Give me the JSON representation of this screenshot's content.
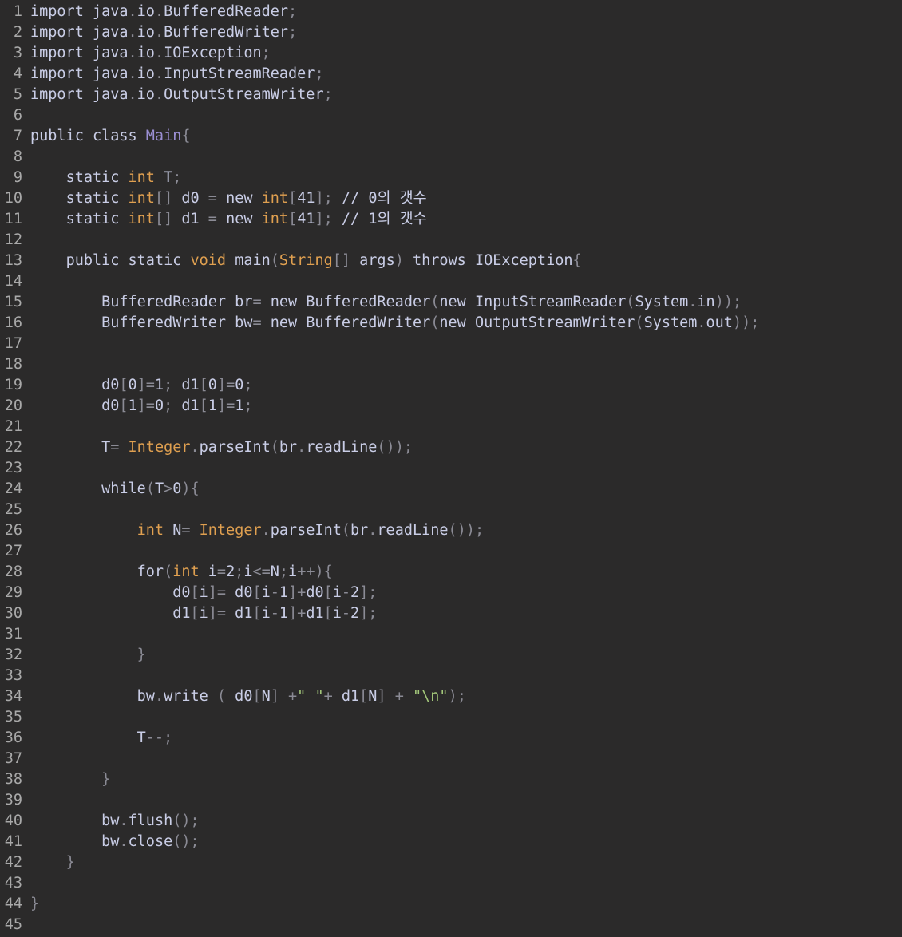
{
  "editor": {
    "language": "java",
    "colors": {
      "background": "#2b2a2a",
      "gutter": "#a9a9a9",
      "keyword": "#c9cde6",
      "type": "#e0a050",
      "class_name": "#9b8fd4",
      "punctuation": "#8b8b95",
      "string": "#a3c77a"
    },
    "lines": [
      [
        {
          "t": "kw",
          "v": "import "
        },
        {
          "t": "plain",
          "v": "java"
        },
        {
          "t": "punc",
          "v": "."
        },
        {
          "t": "plain",
          "v": "io"
        },
        {
          "t": "punc",
          "v": "."
        },
        {
          "t": "plain",
          "v": "BufferedReader"
        },
        {
          "t": "punc",
          "v": ";"
        }
      ],
      [
        {
          "t": "kw",
          "v": "import "
        },
        {
          "t": "plain",
          "v": "java"
        },
        {
          "t": "punc",
          "v": "."
        },
        {
          "t": "plain",
          "v": "io"
        },
        {
          "t": "punc",
          "v": "."
        },
        {
          "t": "plain",
          "v": "BufferedWriter"
        },
        {
          "t": "punc",
          "v": ";"
        }
      ],
      [
        {
          "t": "kw",
          "v": "import "
        },
        {
          "t": "plain",
          "v": "java"
        },
        {
          "t": "punc",
          "v": "."
        },
        {
          "t": "plain",
          "v": "io"
        },
        {
          "t": "punc",
          "v": "."
        },
        {
          "t": "plain",
          "v": "IOException"
        },
        {
          "t": "punc",
          "v": ";"
        }
      ],
      [
        {
          "t": "kw",
          "v": "import "
        },
        {
          "t": "plain",
          "v": "java"
        },
        {
          "t": "punc",
          "v": "."
        },
        {
          "t": "plain",
          "v": "io"
        },
        {
          "t": "punc",
          "v": "."
        },
        {
          "t": "plain",
          "v": "InputStreamReader"
        },
        {
          "t": "punc",
          "v": ";"
        }
      ],
      [
        {
          "t": "kw",
          "v": "import "
        },
        {
          "t": "plain",
          "v": "java"
        },
        {
          "t": "punc",
          "v": "."
        },
        {
          "t": "plain",
          "v": "io"
        },
        {
          "t": "punc",
          "v": "."
        },
        {
          "t": "plain",
          "v": "OutputStreamWriter"
        },
        {
          "t": "punc",
          "v": ";"
        }
      ],
      [],
      [
        {
          "t": "kw",
          "v": "public class "
        },
        {
          "t": "cls",
          "v": "Main"
        },
        {
          "t": "punc",
          "v": "{"
        }
      ],
      [],
      [
        {
          "t": "plain",
          "v": "    "
        },
        {
          "t": "kw",
          "v": "static "
        },
        {
          "t": "type",
          "v": "int"
        },
        {
          "t": "plain",
          "v": " T"
        },
        {
          "t": "punc",
          "v": ";"
        }
      ],
      [
        {
          "t": "plain",
          "v": "    "
        },
        {
          "t": "kw",
          "v": "static "
        },
        {
          "t": "type",
          "v": "int"
        },
        {
          "t": "punc",
          "v": "[]"
        },
        {
          "t": "plain",
          "v": " d0 "
        },
        {
          "t": "punc",
          "v": "="
        },
        {
          "t": "kw",
          "v": " new "
        },
        {
          "t": "type",
          "v": "int"
        },
        {
          "t": "punc",
          "v": "["
        },
        {
          "t": "plain",
          "v": "41"
        },
        {
          "t": "punc",
          "v": "];"
        },
        {
          "t": "plain",
          "v": " // 0의 갯수"
        }
      ],
      [
        {
          "t": "plain",
          "v": "    "
        },
        {
          "t": "kw",
          "v": "static "
        },
        {
          "t": "type",
          "v": "int"
        },
        {
          "t": "punc",
          "v": "[]"
        },
        {
          "t": "plain",
          "v": " d1 "
        },
        {
          "t": "punc",
          "v": "="
        },
        {
          "t": "kw",
          "v": " new "
        },
        {
          "t": "type",
          "v": "int"
        },
        {
          "t": "punc",
          "v": "["
        },
        {
          "t": "plain",
          "v": "41"
        },
        {
          "t": "punc",
          "v": "];"
        },
        {
          "t": "plain",
          "v": " // 1의 갯수"
        }
      ],
      [],
      [
        {
          "t": "plain",
          "v": "    "
        },
        {
          "t": "kw",
          "v": "public static "
        },
        {
          "t": "type",
          "v": "void"
        },
        {
          "t": "plain",
          "v": " main"
        },
        {
          "t": "punc",
          "v": "("
        },
        {
          "t": "type",
          "v": "String"
        },
        {
          "t": "punc",
          "v": "[]"
        },
        {
          "t": "plain",
          "v": " args"
        },
        {
          "t": "punc",
          "v": ")"
        },
        {
          "t": "kw",
          "v": " throws "
        },
        {
          "t": "plain",
          "v": "IOException"
        },
        {
          "t": "punc",
          "v": "{"
        }
      ],
      [],
      [
        {
          "t": "plain",
          "v": "        BufferedReader br"
        },
        {
          "t": "punc",
          "v": "="
        },
        {
          "t": "kw",
          "v": " new "
        },
        {
          "t": "plain",
          "v": "BufferedReader"
        },
        {
          "t": "punc",
          "v": "("
        },
        {
          "t": "kw",
          "v": "new "
        },
        {
          "t": "plain",
          "v": "InputStreamReader"
        },
        {
          "t": "punc",
          "v": "("
        },
        {
          "t": "plain",
          "v": "System"
        },
        {
          "t": "punc",
          "v": "."
        },
        {
          "t": "plain",
          "v": "in"
        },
        {
          "t": "punc",
          "v": "));"
        }
      ],
      [
        {
          "t": "plain",
          "v": "        BufferedWriter bw"
        },
        {
          "t": "punc",
          "v": "="
        },
        {
          "t": "kw",
          "v": " new "
        },
        {
          "t": "plain",
          "v": "BufferedWriter"
        },
        {
          "t": "punc",
          "v": "("
        },
        {
          "t": "kw",
          "v": "new "
        },
        {
          "t": "plain",
          "v": "OutputStreamWriter"
        },
        {
          "t": "punc",
          "v": "("
        },
        {
          "t": "plain",
          "v": "System"
        },
        {
          "t": "punc",
          "v": "."
        },
        {
          "t": "plain",
          "v": "out"
        },
        {
          "t": "punc",
          "v": "));"
        }
      ],
      [],
      [],
      [
        {
          "t": "plain",
          "v": "        d0"
        },
        {
          "t": "punc",
          "v": "["
        },
        {
          "t": "plain",
          "v": "0"
        },
        {
          "t": "punc",
          "v": "]="
        },
        {
          "t": "plain",
          "v": "1"
        },
        {
          "t": "punc",
          "v": ";"
        },
        {
          "t": "plain",
          "v": " d1"
        },
        {
          "t": "punc",
          "v": "["
        },
        {
          "t": "plain",
          "v": "0"
        },
        {
          "t": "punc",
          "v": "]="
        },
        {
          "t": "plain",
          "v": "0"
        },
        {
          "t": "punc",
          "v": ";"
        }
      ],
      [
        {
          "t": "plain",
          "v": "        d0"
        },
        {
          "t": "punc",
          "v": "["
        },
        {
          "t": "plain",
          "v": "1"
        },
        {
          "t": "punc",
          "v": "]="
        },
        {
          "t": "plain",
          "v": "0"
        },
        {
          "t": "punc",
          "v": ";"
        },
        {
          "t": "plain",
          "v": " d1"
        },
        {
          "t": "punc",
          "v": "["
        },
        {
          "t": "plain",
          "v": "1"
        },
        {
          "t": "punc",
          "v": "]="
        },
        {
          "t": "plain",
          "v": "1"
        },
        {
          "t": "punc",
          "v": ";"
        }
      ],
      [],
      [
        {
          "t": "plain",
          "v": "        T"
        },
        {
          "t": "punc",
          "v": "="
        },
        {
          "t": "type",
          "v": " Integer"
        },
        {
          "t": "punc",
          "v": "."
        },
        {
          "t": "plain",
          "v": "parseInt"
        },
        {
          "t": "punc",
          "v": "("
        },
        {
          "t": "plain",
          "v": "br"
        },
        {
          "t": "punc",
          "v": "."
        },
        {
          "t": "plain",
          "v": "readLine"
        },
        {
          "t": "punc",
          "v": "());"
        }
      ],
      [],
      [
        {
          "t": "plain",
          "v": "        "
        },
        {
          "t": "kw",
          "v": "while"
        },
        {
          "t": "punc",
          "v": "("
        },
        {
          "t": "plain",
          "v": "T"
        },
        {
          "t": "punc",
          "v": ">"
        },
        {
          "t": "plain",
          "v": "0"
        },
        {
          "t": "punc",
          "v": "){"
        }
      ],
      [],
      [
        {
          "t": "plain",
          "v": "            "
        },
        {
          "t": "type",
          "v": "int"
        },
        {
          "t": "plain",
          "v": " N"
        },
        {
          "t": "punc",
          "v": "="
        },
        {
          "t": "type",
          "v": " Integer"
        },
        {
          "t": "punc",
          "v": "."
        },
        {
          "t": "plain",
          "v": "parseInt"
        },
        {
          "t": "punc",
          "v": "("
        },
        {
          "t": "plain",
          "v": "br"
        },
        {
          "t": "punc",
          "v": "."
        },
        {
          "t": "plain",
          "v": "readLine"
        },
        {
          "t": "punc",
          "v": "());"
        }
      ],
      [],
      [
        {
          "t": "plain",
          "v": "            "
        },
        {
          "t": "kw",
          "v": "for"
        },
        {
          "t": "punc",
          "v": "("
        },
        {
          "t": "type",
          "v": "int"
        },
        {
          "t": "plain",
          "v": " i"
        },
        {
          "t": "punc",
          "v": "="
        },
        {
          "t": "plain",
          "v": "2"
        },
        {
          "t": "punc",
          "v": ";"
        },
        {
          "t": "plain",
          "v": "i"
        },
        {
          "t": "punc",
          "v": "<="
        },
        {
          "t": "plain",
          "v": "N"
        },
        {
          "t": "punc",
          "v": ";"
        },
        {
          "t": "plain",
          "v": "i"
        },
        {
          "t": "punc",
          "v": "++){"
        }
      ],
      [
        {
          "t": "plain",
          "v": "                d0"
        },
        {
          "t": "punc",
          "v": "["
        },
        {
          "t": "plain",
          "v": "i"
        },
        {
          "t": "punc",
          "v": "]="
        },
        {
          "t": "plain",
          "v": " d0"
        },
        {
          "t": "punc",
          "v": "["
        },
        {
          "t": "plain",
          "v": "i"
        },
        {
          "t": "punc",
          "v": "-"
        },
        {
          "t": "plain",
          "v": "1"
        },
        {
          "t": "punc",
          "v": "]+"
        },
        {
          "t": "plain",
          "v": "d0"
        },
        {
          "t": "punc",
          "v": "["
        },
        {
          "t": "plain",
          "v": "i"
        },
        {
          "t": "punc",
          "v": "-"
        },
        {
          "t": "plain",
          "v": "2"
        },
        {
          "t": "punc",
          "v": "];"
        }
      ],
      [
        {
          "t": "plain",
          "v": "                d1"
        },
        {
          "t": "punc",
          "v": "["
        },
        {
          "t": "plain",
          "v": "i"
        },
        {
          "t": "punc",
          "v": "]="
        },
        {
          "t": "plain",
          "v": " d1"
        },
        {
          "t": "punc",
          "v": "["
        },
        {
          "t": "plain",
          "v": "i"
        },
        {
          "t": "punc",
          "v": "-"
        },
        {
          "t": "plain",
          "v": "1"
        },
        {
          "t": "punc",
          "v": "]+"
        },
        {
          "t": "plain",
          "v": "d1"
        },
        {
          "t": "punc",
          "v": "["
        },
        {
          "t": "plain",
          "v": "i"
        },
        {
          "t": "punc",
          "v": "-"
        },
        {
          "t": "plain",
          "v": "2"
        },
        {
          "t": "punc",
          "v": "];"
        }
      ],
      [],
      [
        {
          "t": "plain",
          "v": "            "
        },
        {
          "t": "punc",
          "v": "}"
        }
      ],
      [],
      [
        {
          "t": "plain",
          "v": "            bw"
        },
        {
          "t": "punc",
          "v": "."
        },
        {
          "t": "plain",
          "v": "write "
        },
        {
          "t": "punc",
          "v": "("
        },
        {
          "t": "plain",
          "v": " d0"
        },
        {
          "t": "punc",
          "v": "["
        },
        {
          "t": "plain",
          "v": "N"
        },
        {
          "t": "punc",
          "v": "]"
        },
        {
          "t": "plain",
          "v": " "
        },
        {
          "t": "punc",
          "v": "+"
        },
        {
          "t": "str",
          "v": "\" \""
        },
        {
          "t": "punc",
          "v": "+"
        },
        {
          "t": "plain",
          "v": " d1"
        },
        {
          "t": "punc",
          "v": "["
        },
        {
          "t": "plain",
          "v": "N"
        },
        {
          "t": "punc",
          "v": "]"
        },
        {
          "t": "plain",
          "v": " "
        },
        {
          "t": "punc",
          "v": "+"
        },
        {
          "t": "plain",
          "v": " "
        },
        {
          "t": "str",
          "v": "\"\\n\""
        },
        {
          "t": "punc",
          "v": ");"
        }
      ],
      [],
      [
        {
          "t": "plain",
          "v": "            T"
        },
        {
          "t": "punc",
          "v": "--;"
        }
      ],
      [],
      [
        {
          "t": "plain",
          "v": "        "
        },
        {
          "t": "punc",
          "v": "}"
        }
      ],
      [],
      [
        {
          "t": "plain",
          "v": "        bw"
        },
        {
          "t": "punc",
          "v": "."
        },
        {
          "t": "plain",
          "v": "flush"
        },
        {
          "t": "punc",
          "v": "();"
        }
      ],
      [
        {
          "t": "plain",
          "v": "        bw"
        },
        {
          "t": "punc",
          "v": "."
        },
        {
          "t": "plain",
          "v": "close"
        },
        {
          "t": "punc",
          "v": "();"
        }
      ],
      [
        {
          "t": "plain",
          "v": "    "
        },
        {
          "t": "punc",
          "v": "}"
        }
      ],
      [],
      [
        {
          "t": "punc",
          "v": "}"
        }
      ],
      []
    ]
  }
}
